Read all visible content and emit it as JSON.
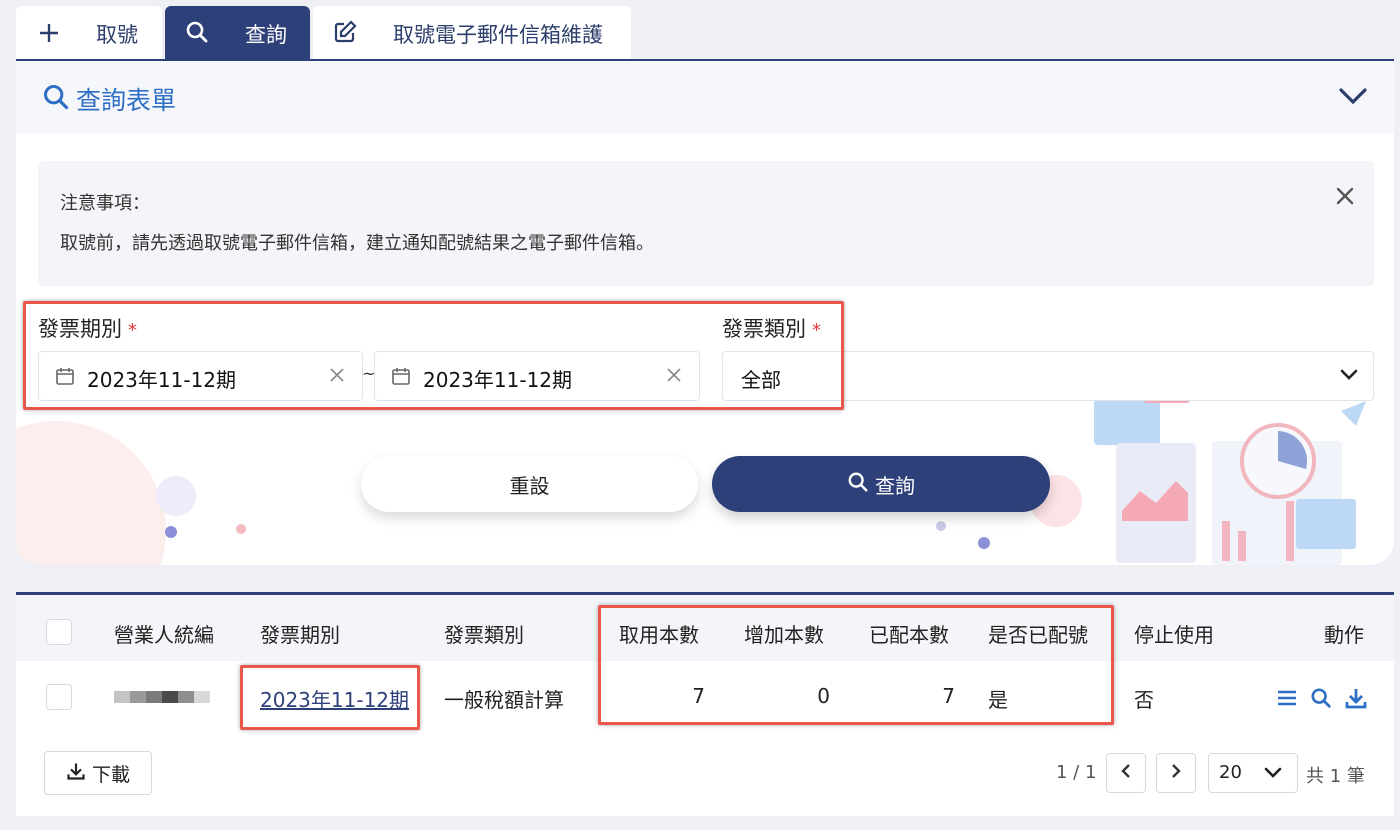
{
  "tabs": [
    {
      "label": "取號",
      "icon": "plus-icon"
    },
    {
      "label": "查詢",
      "icon": "search-icon"
    },
    {
      "label": "取號電子郵件信箱維護",
      "icon": "edit-icon"
    }
  ],
  "query_form": {
    "title": "查詢表單",
    "notice": {
      "title": "注意事項：",
      "text": "取號前，請先透過取號電子郵件信箱，建立通知配號結果之電子郵件信箱。"
    },
    "period_label": "發票期別",
    "required_mark": "*",
    "period_start": "2023年11-12期",
    "period_separator": "~",
    "period_end": "2023年11-12期",
    "type_label": "發票類別",
    "type_value": "全部",
    "reset_label": "重設",
    "query_label": "查詢"
  },
  "results": {
    "columns": [
      "營業人統編",
      "發票期別",
      "發票類別",
      "取用本數",
      "增加本數",
      "已配本數",
      "是否已配號",
      "停止使用",
      "動作"
    ],
    "rows": [
      {
        "tax_id": "",
        "period": "2023年11-12期",
        "type": "一般稅額計算",
        "taken": "7",
        "added": "0",
        "assigned": "7",
        "is_assigned": "是",
        "stopped": "否"
      }
    ],
    "download_label": "下載",
    "page_info": "1 / 1",
    "page_size": "20",
    "total": "共 1 筆"
  },
  "colors": {
    "primary": "#2e4079",
    "link": "#2e6ec4",
    "highlight": "#e8574a"
  }
}
